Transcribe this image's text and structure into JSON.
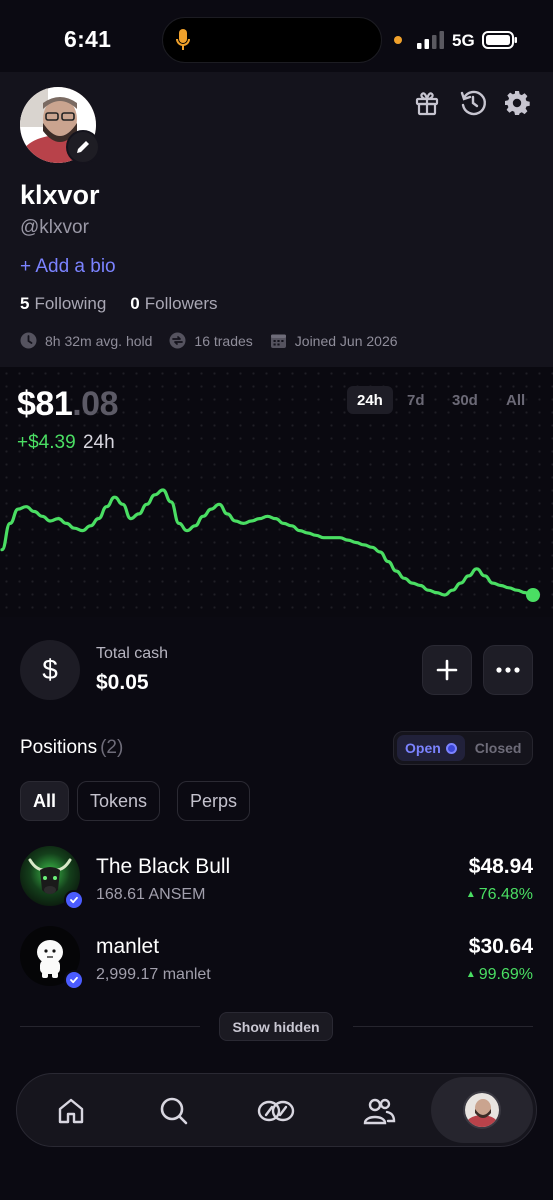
{
  "status_bar": {
    "time": "6:41",
    "network": "5G"
  },
  "profile": {
    "display_name": "klxvor",
    "handle": "@klxvor",
    "add_bio": "+ Add a bio",
    "following_count": "5",
    "following_label": "Following",
    "followers_count": "0",
    "followers_label": "Followers",
    "stats": {
      "avg_hold": "8h 32m avg. hold",
      "trades": "16 trades",
      "joined": "Joined Jun 2026"
    }
  },
  "header_icons": [
    "gift-icon",
    "history-icon",
    "gear-icon"
  ],
  "portfolio": {
    "balance_dollars": "$81",
    "balance_cents": ".08",
    "change": "+$4.39",
    "change_period": "24h",
    "timeframes": [
      "24h",
      "7d",
      "30d",
      "All"
    ],
    "active_timeframe": "24h",
    "line_color": "#4ade63"
  },
  "chart_data": {
    "type": "line",
    "series": [
      {
        "values": [
          75,
          86,
          92,
          93,
          91,
          89,
          87,
          88,
          86,
          84,
          83,
          85,
          88,
          93,
          97,
          94,
          88,
          90,
          94,
          98,
          100,
          95,
          86,
          83,
          85,
          89,
          92,
          94,
          90,
          87,
          86,
          87,
          88,
          89,
          88,
          86,
          85,
          83,
          82,
          81,
          80,
          80,
          80,
          79,
          78,
          77,
          76,
          74,
          70,
          66,
          63,
          61,
          60,
          58,
          57,
          56,
          58,
          61,
          64,
          67,
          64,
          61,
          60,
          59,
          58,
          57,
          56
        ]
      }
    ]
  },
  "cash": {
    "symbol": "$",
    "label": "Total cash",
    "value": "$0.05"
  },
  "positions": {
    "title": "Positions",
    "count": "(2)",
    "toggle_open": "Open",
    "toggle_closed": "Closed",
    "filters": [
      "All",
      "Tokens",
      "Perps"
    ],
    "active_filter": "All",
    "items": [
      {
        "name": "The Black Bull",
        "amount": "168.61 ANSEM",
        "value": "$48.94",
        "change": "76.48%"
      },
      {
        "name": "manlet",
        "amount": "2,999.17 manlet",
        "value": "$30.64",
        "change": "99.69%"
      }
    ],
    "show_hidden": "Show hidden"
  },
  "nav": [
    "home-icon",
    "search-icon",
    "swap-icon",
    "community-icon",
    "profile-avatar"
  ],
  "colors": {
    "accent": "#7b83ff",
    "positive": "#4ade63",
    "background": "#0b0a12"
  }
}
